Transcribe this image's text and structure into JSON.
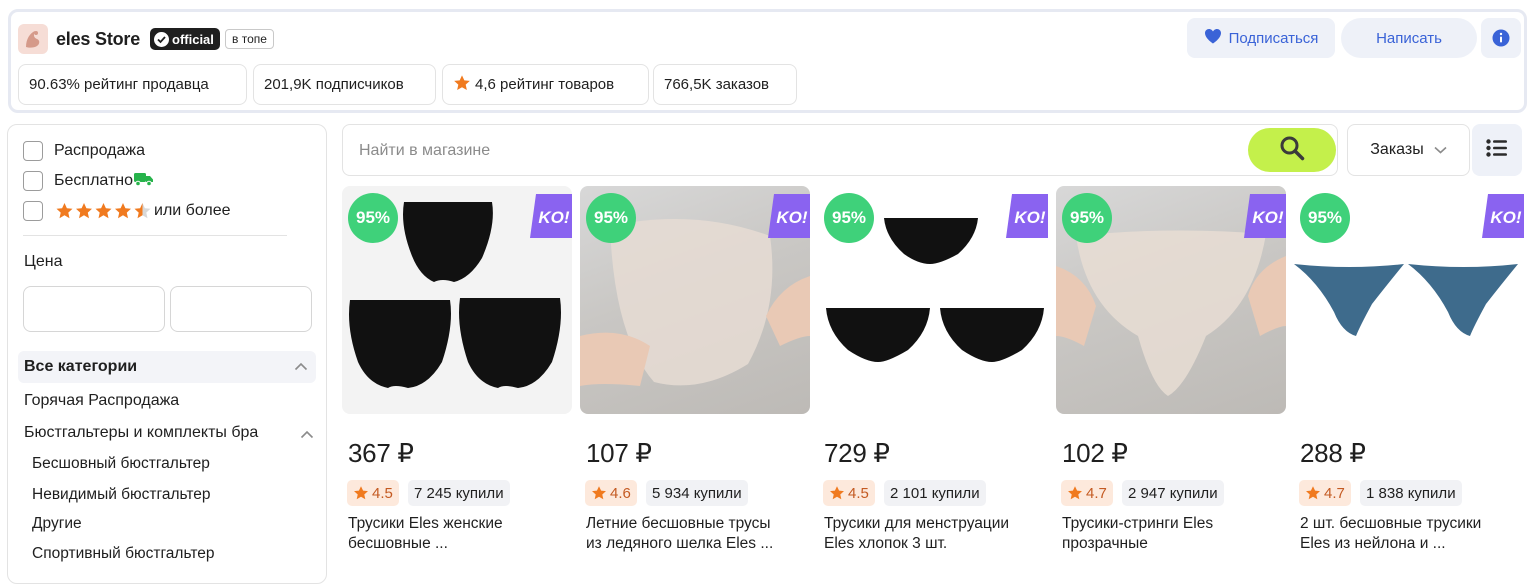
{
  "store": {
    "name": "eles Store",
    "official_label": "official",
    "top_badge": "в топе",
    "stats": [
      {
        "text": "90.63% рейтинг продавца"
      },
      {
        "text": "201,9K подписчиков"
      },
      {
        "text": "4,6 рейтинг товаров"
      },
      {
        "text": "766,5K заказов"
      }
    ],
    "subscribe_label": "Подписаться",
    "write_label": "Написать"
  },
  "filters": {
    "sale": "Распродажа",
    "free": "Бесплатно",
    "rating_suffix": "или более",
    "rating_stars": 4.5,
    "price_label": "Цена",
    "price_from": "",
    "price_to": ""
  },
  "categories": {
    "header": "Все категории",
    "items": [
      {
        "label": "Горячая Распродажа"
      },
      {
        "label": "Бюстгальтеры и комплекты бра"
      },
      {
        "label": "Бесшовный бюстгальтер"
      },
      {
        "label": "Невидимый бюстгальтер"
      },
      {
        "label": "Другие"
      },
      {
        "label": "Спортивный бюстгальтер"
      }
    ]
  },
  "search": {
    "placeholder": "Найти в магазине",
    "sort_label": "Заказы"
  },
  "products": [
    {
      "discount": "95%",
      "price": "367 ₽",
      "rating": "4.5",
      "bought": "7 245 купили",
      "title_line1": "Трусики Eles женские",
      "title_line2": "бесшовные ..."
    },
    {
      "discount": "95%",
      "price": "107 ₽",
      "rating": "4.6",
      "bought": "5 934 купили",
      "title_line1": "Летние бесшовные трусы",
      "title_line2": "из ледяного шелка Eles ..."
    },
    {
      "discount": "95%",
      "price": "729 ₽",
      "rating": "4.5",
      "bought": "2 101 купили",
      "title_line1": "Трусики для менструации",
      "title_line2": "Eles хлопок 3 шт."
    },
    {
      "discount": "95%",
      "price": "102 ₽",
      "rating": "4.7",
      "bought": "2 947 купили",
      "title_line1": "Трусики-стринги Eles",
      "title_line2": "прозрачные"
    },
    {
      "discount": "95%",
      "price": "288 ₽",
      "rating": "4.7",
      "bought": "1 838 купили",
      "title_line1": "2 шт. бесшовные трусики",
      "title_line2": "Eles из нейлона и ..."
    }
  ],
  "promo_badge": "KO!",
  "colors": {
    "accent_blue": "#3a63d7",
    "search_green": "#c4f04b",
    "discount_green": "#3fd17a",
    "rating_orange": "#f07a1f",
    "promo_purple": "#8a63f0",
    "free_truck_green": "#27b34b"
  }
}
